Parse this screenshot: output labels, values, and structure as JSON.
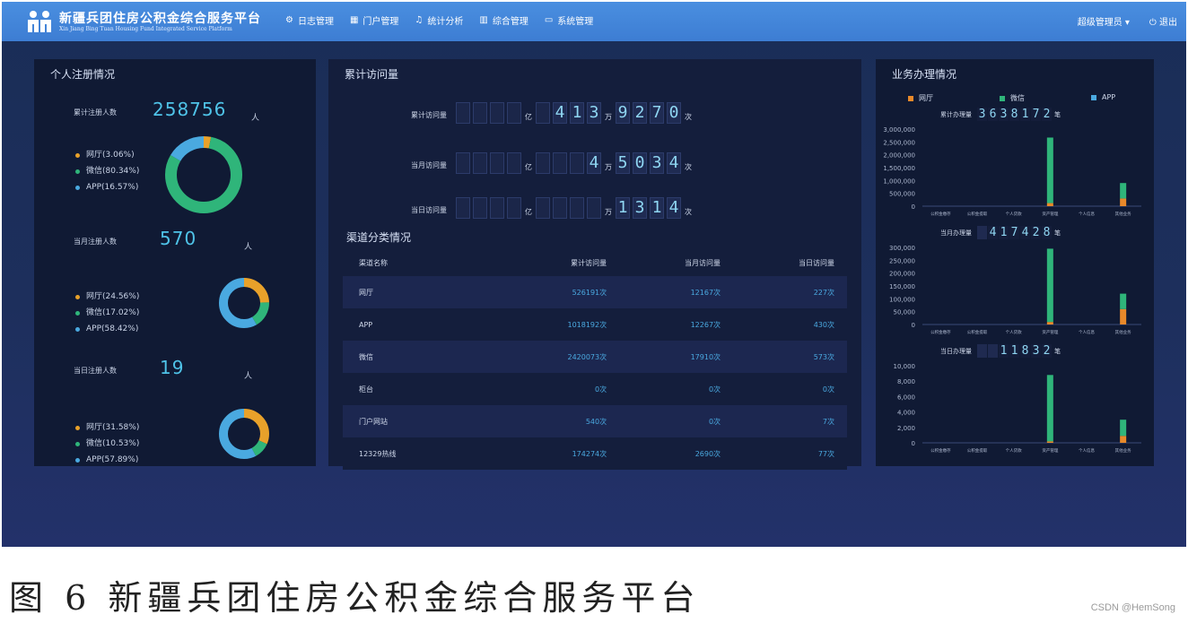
{
  "header": {
    "title": "新疆兵团住房公积金综合服务平台",
    "subtitle": "Xin Jiang Bing Tuan Housing Fund Integrated Service Platform",
    "nav": [
      {
        "label": "日志管理",
        "icon": "gear-icon"
      },
      {
        "label": "门户管理",
        "icon": "grid-icon"
      },
      {
        "label": "统计分析",
        "icon": "bell-icon"
      },
      {
        "label": "综合管理",
        "icon": "bar-chart-icon"
      },
      {
        "label": "系统管理",
        "icon": "folder-icon"
      }
    ],
    "user": "超级管理员 ▾",
    "logout": "⏻ 退出"
  },
  "left": {
    "title": "个人注册情况",
    "stats": [
      {
        "label": "累计注册人数",
        "value": "258756",
        "unit": "人",
        "legend": [
          "网厅(3.06%)",
          "微信(80.34%)",
          "APP(16.57%)"
        ],
        "pct": [
          3.06,
          80.34,
          16.57
        ]
      },
      {
        "label": "当月注册人数",
        "value": "570",
        "unit": "人",
        "legend": [
          "网厅(24.56%)",
          "微信(17.02%)",
          "APP(58.42%)"
        ],
        "pct": [
          24.56,
          17.02,
          58.42
        ]
      },
      {
        "label": "当日注册人数",
        "value": "19",
        "unit": "人",
        "legend": [
          "网厅(31.58%)",
          "微信(10.53%)",
          "APP(57.89%)"
        ],
        "pct": [
          31.58,
          10.53,
          57.89
        ]
      }
    ]
  },
  "center": {
    "title": "累计访问量",
    "counters": [
      {
        "label": "累计访问量",
        "digits": [
          "",
          "",
          "",
          "",
          "亿",
          "",
          "4",
          "1",
          "3",
          "万",
          "9",
          "2",
          "7",
          "0",
          "次"
        ]
      },
      {
        "label": "当月访问量",
        "digits": [
          "",
          "",
          "",
          "",
          "亿",
          "",
          "",
          "",
          "4",
          "万",
          "5",
          "0",
          "3",
          "4",
          "次"
        ]
      },
      {
        "label": "当日访问量",
        "digits": [
          "",
          "",
          "",
          "",
          "亿",
          "",
          "",
          "",
          "",
          "万",
          "1",
          "3",
          "1",
          "4",
          "次"
        ]
      }
    ],
    "channel_title": "渠道分类情况",
    "table": {
      "headers": [
        "渠道名称",
        "累计访问量",
        "当月访问量",
        "当日访问量"
      ],
      "rows": [
        [
          "网厅",
          "526191次",
          "12167次",
          "227次"
        ],
        [
          "APP",
          "1018192次",
          "12267次",
          "430次"
        ],
        [
          "微信",
          "2420073次",
          "17910次",
          "573次"
        ],
        [
          "柜台",
          "0次",
          "0次",
          "0次"
        ],
        [
          "门户网站",
          "540次",
          "0次",
          "7次"
        ],
        [
          "12329热线",
          "174274次",
          "2690次",
          "77次"
        ]
      ]
    }
  },
  "right": {
    "title": "业务办理情况",
    "legend": [
      "网厅",
      "微信",
      "APP"
    ],
    "colors": {
      "wangting": "#e8892a",
      "weixin": "#2fb57a",
      "app": "#4aa9e0"
    },
    "charts": [
      {
        "label": "累计办理量",
        "digits": [
          "3",
          "6",
          "3",
          "8",
          "1",
          "7",
          "2"
        ],
        "unit": "笔",
        "yticks": [
          "3,000,000",
          "2,500,000",
          "2,000,000",
          "1,500,000",
          "1,000,000",
          "500,000",
          "0"
        ],
        "ymax": 3000000,
        "categories": [
          "公积金缴存",
          "公积金提取",
          "个人贷款",
          "资产管理",
          "个人信息",
          "其他业务"
        ],
        "bars": [
          [
            0,
            0
          ],
          [
            0,
            0
          ],
          [
            0,
            0
          ],
          [
            120000,
            2550000
          ],
          [
            0,
            0
          ],
          [
            300000,
            600000
          ]
        ]
      },
      {
        "label": "当月办理量",
        "digits": [
          "",
          "4",
          "1",
          "7",
          "4",
          "2",
          "8"
        ],
        "unit": "笔",
        "yticks": [
          "300,000",
          "250,000",
          "200,000",
          "150,000",
          "100,000",
          "50,000",
          "0"
        ],
        "ymax": 300000,
        "categories": [
          "公积金缴存",
          "公积金提取",
          "个人贷款",
          "资产管理",
          "个人信息",
          "其他业务"
        ],
        "bars": [
          [
            0,
            0
          ],
          [
            0,
            0
          ],
          [
            0,
            0
          ],
          [
            10000,
            285000
          ],
          [
            0,
            0
          ],
          [
            60000,
            60000
          ]
        ]
      },
      {
        "label": "当日办理量",
        "digits": [
          "",
          "",
          "1",
          "1",
          "8",
          "3",
          "2"
        ],
        "unit": "笔",
        "yticks": [
          "10,000",
          "8,000",
          "6,000",
          "4,000",
          "2,000",
          "0"
        ],
        "ymax": 10000,
        "categories": [
          "公积金缴存",
          "公积金提取",
          "个人贷款",
          "资产管理",
          "个人信息",
          "其他业务"
        ],
        "bars": [
          [
            0,
            0
          ],
          [
            0,
            0
          ],
          [
            0,
            0
          ],
          [
            200,
            8600
          ],
          [
            0,
            0
          ],
          [
            900,
            2100
          ]
        ]
      }
    ]
  },
  "caption": "图 6 新疆兵团住房公积金综合服务平台",
  "watermark": "CSDN @HemSong",
  "donut_colors": [
    "#e8a12a",
    "#2fb57a",
    "#4aa9e0"
  ]
}
